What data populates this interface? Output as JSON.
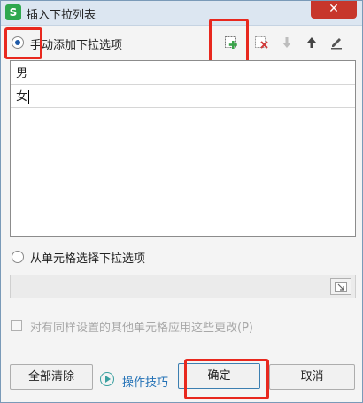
{
  "window": {
    "title": "插入下拉列表",
    "app_icon_letter": "S",
    "close_glyph": "✕"
  },
  "manual": {
    "label": "手动添加下拉选项",
    "selected": true,
    "toolbar": [
      "add-item-icon",
      "delete-item-icon",
      "move-down-icon",
      "move-up-icon",
      "edit-icon"
    ]
  },
  "list": {
    "items": [
      "男",
      "女"
    ]
  },
  "from_cells": {
    "label": "从单元格选择下拉选项",
    "selected": false,
    "input_value": ""
  },
  "apply_checkbox": {
    "label": "对有同样设置的其他单元格应用这些更改(P)",
    "checked": false,
    "enabled": false
  },
  "footer": {
    "clear_all": "全部清除",
    "help_link": "操作技巧",
    "ok": "确定",
    "cancel": "取消"
  },
  "colors": {
    "highlight": "#e8281e",
    "titlebar": "#dce6f1",
    "close": "#c7362b",
    "link": "#1f6fb5",
    "add_icon_green": "#3aa34a",
    "delete_icon_red": "#d23b3b"
  }
}
